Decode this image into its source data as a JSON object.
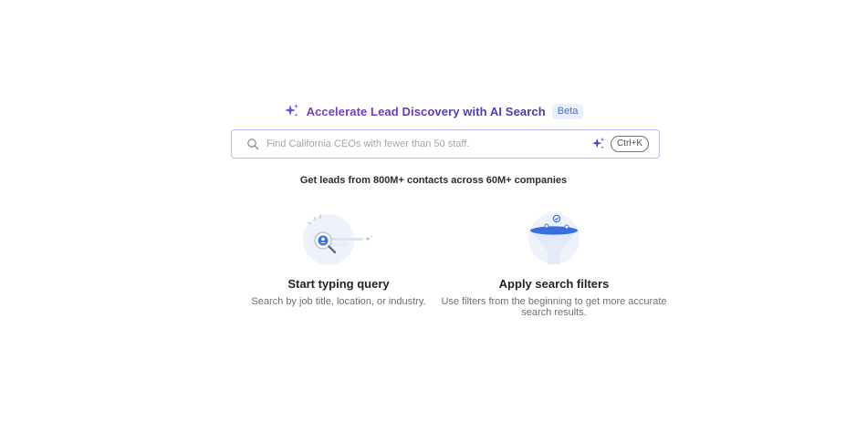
{
  "hero": {
    "title": "Accelerate Lead Discovery with AI Search",
    "badge": "Beta",
    "icon": "sparkle-icon"
  },
  "search": {
    "placeholder": "Find California CEOs with fewer than 50 staff.",
    "value": "",
    "shortcut": "Ctrl+K"
  },
  "tagline": "Get leads from 800M+ contacts across 60M+ companies",
  "features": [
    {
      "icon": "search-person-icon",
      "title": "Start typing query",
      "description": "Search by job title, location, or industry."
    },
    {
      "icon": "filter-funnel-icon",
      "title": "Apply search filters",
      "description": "Use filters from the beginning to get more accurate search results."
    }
  ],
  "colors": {
    "accent": "#5b3ab8",
    "badge_bg": "#eaf1fc",
    "badge_text": "#4d6bd6",
    "search_border": "#b8b6e8",
    "illustration_blue": "#3b6fe0"
  }
}
